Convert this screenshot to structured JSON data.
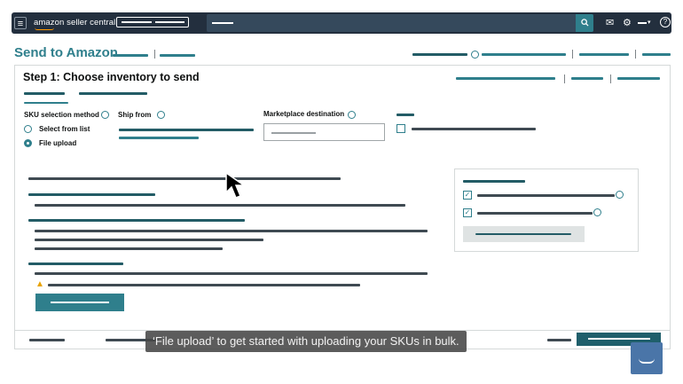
{
  "nav": {
    "menu_icon": "hamburger-menu-icon",
    "logo_text": "amazon seller central",
    "search_icon": "search-icon",
    "icons": [
      "mail-icon",
      "gear-icon",
      "chevron-down-icon",
      "help-icon"
    ],
    "help_glyph": "?"
  },
  "page": {
    "title": "Send to Amazon"
  },
  "step": {
    "title": "Step 1: Choose inventory to send",
    "sku_method_label": "SKU selection method",
    "options": [
      "Select from list",
      "File upload"
    ],
    "selected_option": "File upload",
    "ship_from_label": "Ship from",
    "marketplace_label": "Marketplace destination"
  },
  "caption": {
    "text": "‘File upload’ to get started with uploading your SKUs in bulk."
  },
  "colors": {
    "accent": "#2f7f8c",
    "nav_bg": "#232f3e",
    "title": "#2f7f8c",
    "warning": "#e8a300"
  }
}
